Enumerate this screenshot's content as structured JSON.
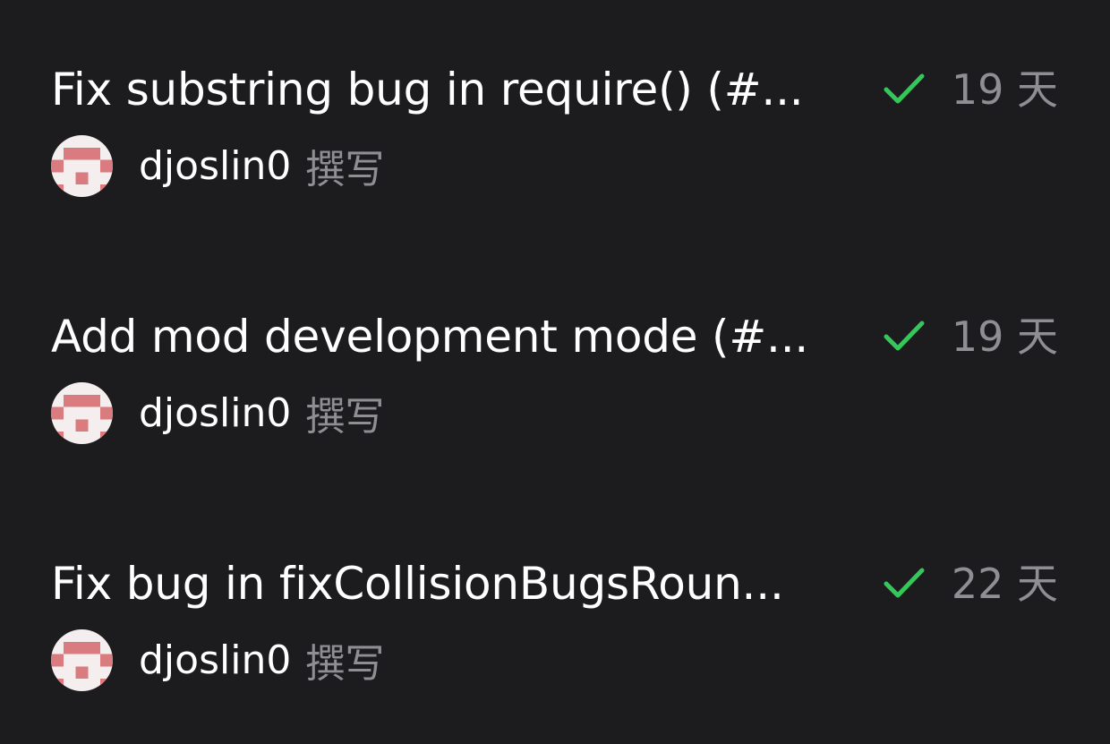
{
  "colors": {
    "background": "#1c1c1f",
    "title_text": "#ffffff",
    "secondary_text": "#8e8e93",
    "success_check": "#34c759",
    "avatar_background": "#f5eeee",
    "avatar_pattern": "#d97b7f"
  },
  "commits": [
    {
      "title": "Fix substring bug in require() (#...",
      "status_icon": "check-icon",
      "time": "19 天",
      "author": "djoslin0",
      "authored_label": "撰写"
    },
    {
      "title": "Add mod development mode (#...",
      "status_icon": "check-icon",
      "time": "19 天",
      "author": "djoslin0",
      "authored_label": "撰写"
    },
    {
      "title": "Fix bug in fixCollisionBugsRoun...",
      "status_icon": "check-icon",
      "time": "22 天",
      "author": "djoslin0",
      "authored_label": "撰写"
    }
  ]
}
